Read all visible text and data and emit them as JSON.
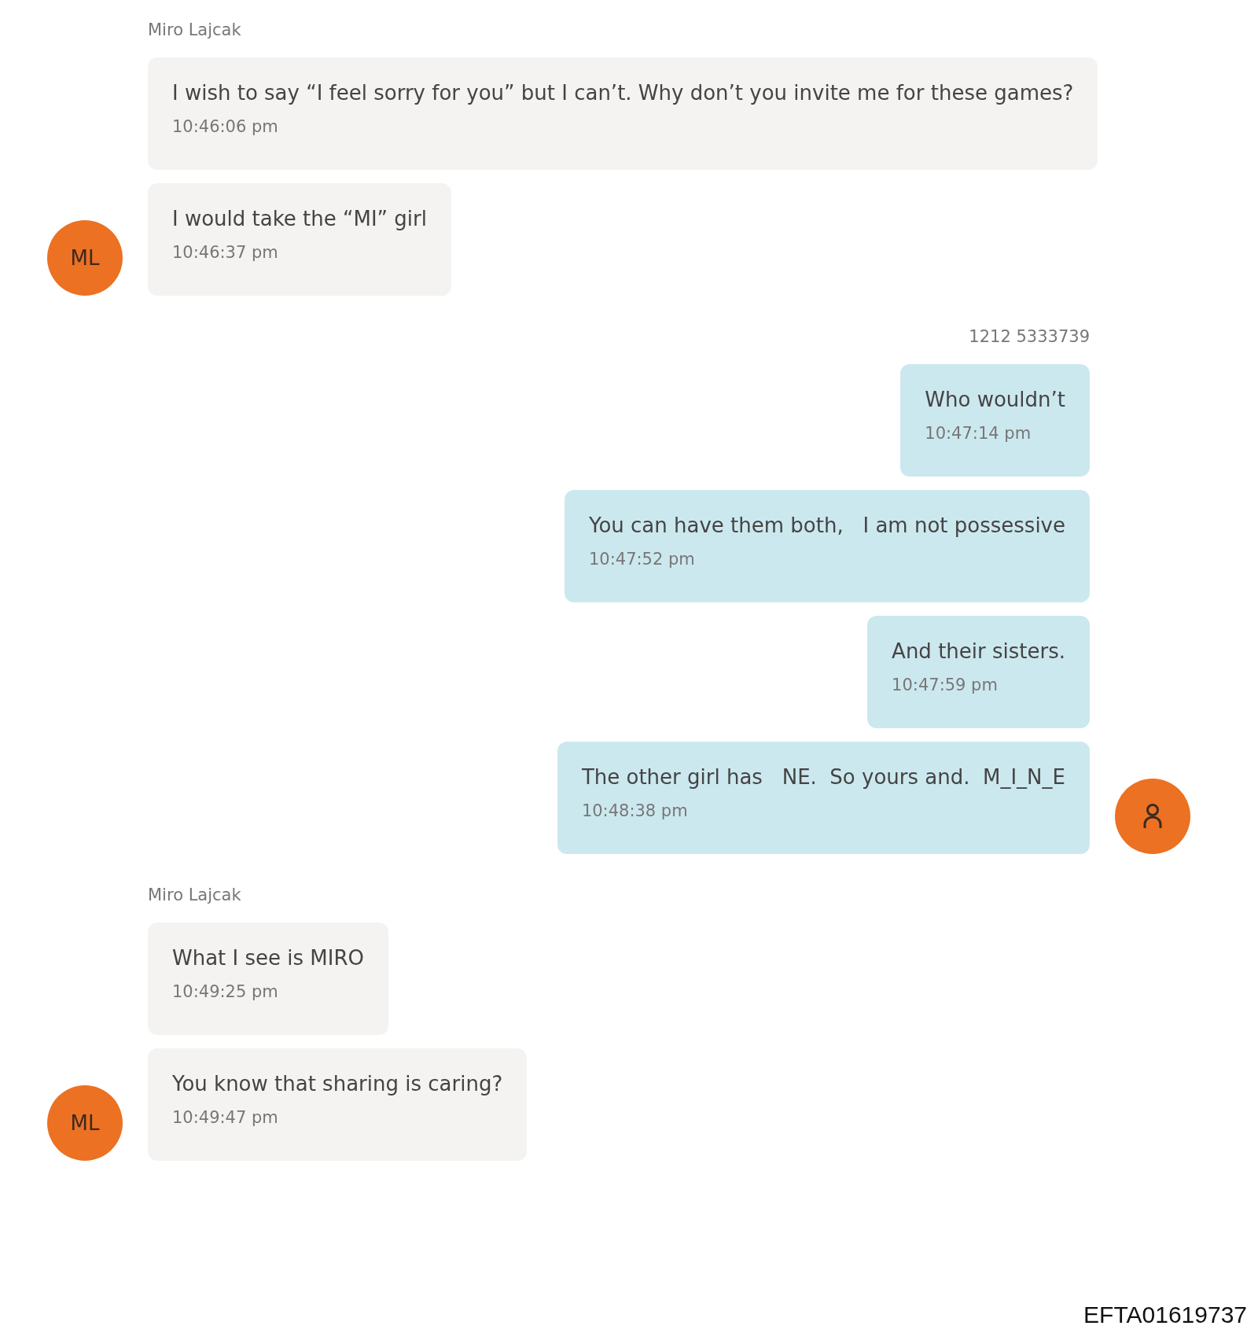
{
  "groups": [
    {
      "kind": "incoming",
      "sender": "Miro Lajcak",
      "avatar": {
        "kind": "initials",
        "text": "ML"
      },
      "messages": [
        {
          "text": "I wish to say “I feel sorry for you” but I can’t. Why don’t you invite me for these games?",
          "time": "10:46:06 pm"
        },
        {
          "text": "I would take the “MI” girl",
          "time": "10:46:37 pm"
        }
      ]
    },
    {
      "kind": "outgoing",
      "sender": "1212 5333739",
      "avatar": {
        "kind": "person"
      },
      "messages": [
        {
          "text": "Who wouldn’t",
          "time": "10:47:14 pm"
        },
        {
          "text": "You can have them both,   I am not possessive",
          "time": "10:47:52 pm"
        },
        {
          "text": "And their sisters.",
          "time": "10:47:59 pm"
        },
        {
          "text": "The other girl has   NE.  So yours and.  M_I_N_E",
          "time": "10:48:38 pm"
        }
      ]
    },
    {
      "kind": "incoming",
      "sender": "Miro Lajcak",
      "avatar": {
        "kind": "initials",
        "text": "ML"
      },
      "messages": [
        {
          "text": "What I see is MIRO",
          "time": "10:49:25 pm"
        },
        {
          "text": "You know that sharing is caring?",
          "time": "10:49:47 pm"
        }
      ]
    }
  ],
  "footer": "EFTA01619737"
}
